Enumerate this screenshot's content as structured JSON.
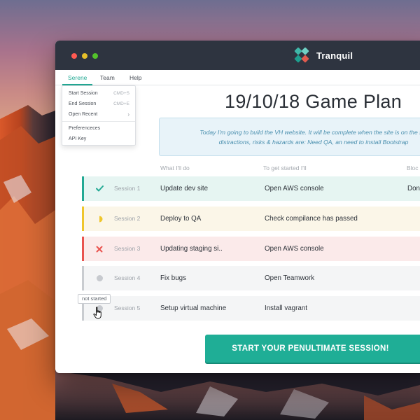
{
  "app": {
    "name": "Tranquil"
  },
  "menu": {
    "items": [
      {
        "label": "Serene",
        "active": true
      },
      {
        "label": "Team",
        "active": false
      },
      {
        "label": "Help",
        "active": false
      }
    ],
    "dropdown": {
      "start_session": {
        "label": "Start Session",
        "shortcut": "CMD+S"
      },
      "end_session": {
        "label": "End Session",
        "shortcut": "CMD+E"
      },
      "open_recent": {
        "label": "Open Recent"
      },
      "preferences": {
        "label": "Preferenceces"
      },
      "api_key": {
        "label": "API Key"
      }
    }
  },
  "page": {
    "title": "19/10/18 Game Plan",
    "intro_line1": "Today I'm going to build the VH website. It will be complete when the site is on the sta",
    "intro_line2": "distractions, risks & hazards are: Need QA, an need to install Bootstrap"
  },
  "table": {
    "headers": [
      "What I'll do",
      "To get started I'll",
      "Bloc"
    ],
    "rows": [
      {
        "status": "done",
        "session": "Session 1",
        "what": "Update dev site",
        "start": "Open AWS console",
        "block": "Don"
      },
      {
        "status": "in-progress",
        "session": "Session 2",
        "what": "Deploy to QA",
        "start": "Check compilance has passed",
        "block": ""
      },
      {
        "status": "failed",
        "session": "Session 3",
        "what": "Updating staging si..",
        "start": "Open AWS console",
        "block": ""
      },
      {
        "status": "not-started",
        "session": "Session 4",
        "what": "Fix bugs",
        "start": "Open Teamwork",
        "block": ""
      },
      {
        "status": "not-started",
        "session": "Session 5",
        "what": "Setup virtual machine",
        "start": "Install vagrant",
        "block": ""
      }
    ]
  },
  "tooltip": {
    "text": "not started"
  },
  "cta": {
    "label": "START YOUR PENULTIMATE SESSION!"
  },
  "colors": {
    "accent": "#23a994",
    "titlebar": "#2e3440",
    "done": "#23a994",
    "in_progress": "#efc62c",
    "failed": "#e9534f",
    "not_started": "#c9ccd0"
  },
  "icons": {
    "logo": "diamond-cluster-logo",
    "done": "check-icon",
    "in_progress": "half-circle-icon",
    "failed": "x-icon",
    "not_started": "dot-icon",
    "cursor": "hand-pointer-icon"
  }
}
